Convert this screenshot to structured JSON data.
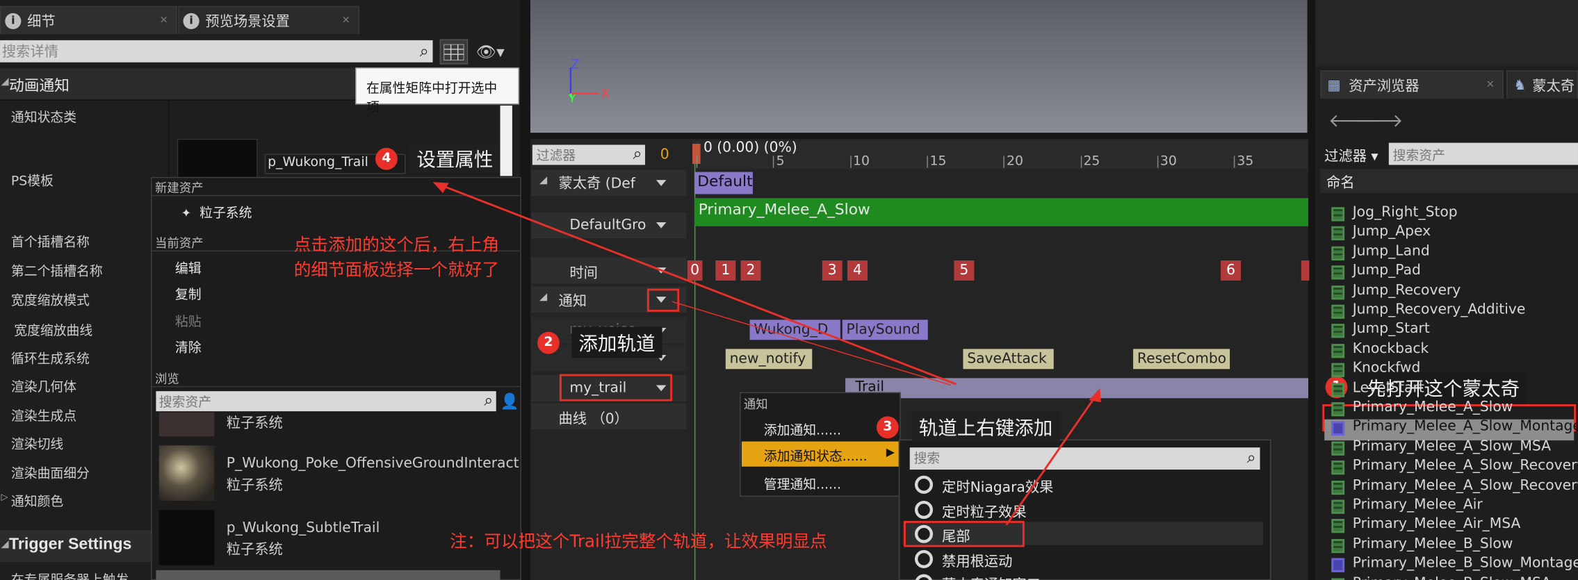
{
  "left_panel": {
    "tab_details": "细节",
    "tab_preview": "预览场景设置",
    "search_placeholder": "搜索详情",
    "section_title": "动画通知",
    "labels": [
      "通知状态类",
      "PS模板",
      "首个插槽名称",
      "第二个插槽名称",
      "宽度缩放模式",
      "宽度缩放曲线",
      "循环生成系统",
      "渲染几何体",
      "渲染生成点",
      "渲染切线",
      "渲染曲面细分",
      "通知颜色"
    ],
    "trigger_settings": "Trigger Settings",
    "trigger_sub": "在专属服务器上触发",
    "tooltip": "在属性矩阵中打开选中项",
    "ps_value": "p_Wukong_Trail"
  },
  "popup_menu": {
    "new_asset_header": "新建资产",
    "new_asset_item": "粒子系统",
    "current_asset_header": "当前资产",
    "edit": "编辑",
    "copy": "复制",
    "paste": "粘贴",
    "clear": "清除",
    "browse_header": "浏览",
    "search_placeholder": "搜索资产",
    "assets": [
      {
        "name": "",
        "type": "粒子系统"
      },
      {
        "name": "P_Wukong_Poke_OffensiveGroundInteract",
        "type": "粒子系统"
      },
      {
        "name": "p_Wukong_SubtleTrail",
        "type": "粒子系统"
      }
    ]
  },
  "timeline": {
    "filter_placeholder": "过滤器",
    "filter_count": "0",
    "time_readout": "0 (0.00) (0%)",
    "ticks": [
      "0",
      "5",
      "10",
      "15",
      "20",
      "25",
      "30",
      "35"
    ],
    "tracks": {
      "montage": "蒙太奇 (Def",
      "default_group": "DefaultGro",
      "time": "时间",
      "notify": "通知",
      "my_voice": "my_voice",
      "my_trail": "my_trail",
      "curves": "曲线 （0）"
    },
    "default_section": "Default",
    "slot_bar": "Primary_Melee_A_Slow",
    "markers": [
      "0",
      "1",
      "2",
      "3",
      "4",
      "5",
      "6"
    ],
    "notifies": [
      "Wukong_D",
      "PlaySound",
      "new_notify",
      "SaveAttack",
      "ResetCombo",
      "Trail"
    ]
  },
  "context_menu": {
    "header": "通知",
    "add_notify": "添加通知......",
    "add_notify_state": "添加通知状态......",
    "manage_notify": "管理通知......",
    "search_placeholder": "搜索",
    "options": [
      "定时Niagara效果",
      "定时粒子效果",
      "尾部",
      "禁用根运动",
      "蒙太奇通知窗口"
    ]
  },
  "asset_browser": {
    "tab_assets": "资产浏览器",
    "tab_montage": "蒙太奇",
    "filters": "过滤器",
    "search_placeholder": "搜索资产",
    "column_name": "命名",
    "items": [
      "Jog_Right_Stop",
      "Jump_Apex",
      "Jump_Land",
      "Jump_Pad",
      "Jump_Recovery",
      "Jump_Recovery_Additive",
      "Jump_Start",
      "Knockback",
      "Knockfwd",
      "LevelStart",
      "Primary_Melee_A_Slow",
      "Primary_Melee_A_Slow_Montage",
      "Primary_Melee_A_Slow_MSA",
      "Primary_Melee_A_Slow_Recovery",
      "Primary_Melee_A_Slow_Recovery_",
      "Primary_Melee_Air",
      "Primary_Melee_Air_MSA",
      "Primary_Melee_B_Slow",
      "Primary_Melee_B_Slow_Montage",
      "Primary_Melee_B_Slow_MSA"
    ]
  },
  "viewport": {
    "axis_z": "Z",
    "axis_y": "Y",
    "axis_x": "X"
  },
  "annotations": {
    "step1": "1",
    "step1_text": "先打开这个蒙太奇",
    "step2": "2",
    "step2_text": "添加轨道",
    "step3": "3",
    "step3_text": "轨道上右键添加",
    "step4": "4",
    "step4_text": "设置属性",
    "note_click": "点击添加的这个后，右上角的细节面板选择一个就好了",
    "note_click_1": "点击添加的这个后，右上角",
    "note_click_2": "的细节面板选择一个就好了",
    "note_bottom": "注：可以把这个Trail拉完整个轨道，让效果明显点"
  },
  "colors": {
    "accent_red": "#e8302a",
    "highlight_orange": "#e6a312",
    "slot_green": "#1f8a1f",
    "notify_purple": "#8a78c8",
    "montage_icon": "#6a63d9"
  }
}
